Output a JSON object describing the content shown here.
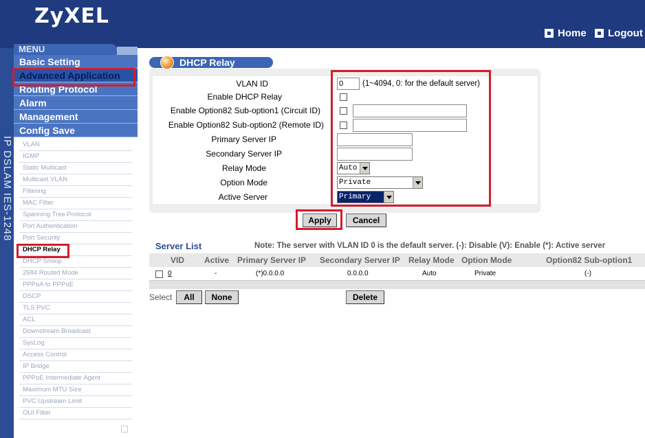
{
  "header": {
    "logo": "ZyXEL",
    "home_label": "Home",
    "logout_label": "Logout",
    "device_name": "IP DSLAM IES-1248"
  },
  "menu": {
    "title": "MENU",
    "items": [
      {
        "label": "Basic Setting"
      },
      {
        "label": "Advanced Application"
      },
      {
        "label": "Routing Protocol"
      },
      {
        "label": "Alarm"
      },
      {
        "label": "Management"
      },
      {
        "label": "Config Save"
      }
    ],
    "subitems": [
      "VLAN",
      "IGMP",
      "Static Multicast",
      "Multicast VLAN",
      "Filtering",
      "MAC Filter",
      "Spanning Tree Protocol",
      "Port Authentication",
      "Port Security",
      "DHCP Relay",
      "DHCP Snoop",
      "2684 Routed Mode",
      "PPPoA to PPPoE",
      "DSCP",
      "TLS PVC",
      "ACL",
      "Downstream Broadcast",
      "SysLog",
      "Access Control",
      "IP Bridge",
      "PPPoE Intermediate Agent",
      "Maximum MTU Size",
      "PVC Upstream Limit",
      "OUI Filter"
    ]
  },
  "panel": {
    "title": "DHCP Relay",
    "labels": {
      "vlan_id": "VLAN ID",
      "enable_relay": "Enable DHCP Relay",
      "opt82_sub1": "Enable Option82 Sub-option1 (Circuit ID)",
      "opt82_sub2": "Enable Option82 Sub-option2 (Remote ID)",
      "primary_ip": "Primary Server IP",
      "secondary_ip": "Secondary Server IP",
      "relay_mode": "Relay Mode",
      "option_mode": "Option Mode",
      "active_server": "Active Server"
    },
    "vlan_id_value": "0",
    "vlan_hint": "(1~4094, 0: for the default server)",
    "relay_mode_value": "Auto",
    "option_mode_value": "Private",
    "active_server_value": "Primary",
    "apply_label": "Apply",
    "cancel_label": "Cancel"
  },
  "server_list": {
    "title": "Server List",
    "note": "Note: The server with VLAN ID 0 is the default server. (-): Disable (V): Enable (*): Active server",
    "columns": [
      "VID",
      "Active",
      "Primary Server IP",
      "Secondary Server IP",
      "Relay Mode",
      "Option Mode",
      "Option82 Sub-option1"
    ],
    "rows": [
      {
        "vid": "0",
        "active": "-",
        "primary": "(*)0.0.0.0",
        "secondary": "0.0.0.0",
        "relay": "Auto",
        "option": "Private",
        "opt82": "(-)"
      }
    ],
    "select_label": "Select",
    "all_label": "All",
    "none_label": "None",
    "delete_label": "Delete"
  },
  "colors": {
    "header_bg": "#1f3a7e",
    "menu_bg": "#4a74c2",
    "highlight": "#d21c2b"
  }
}
